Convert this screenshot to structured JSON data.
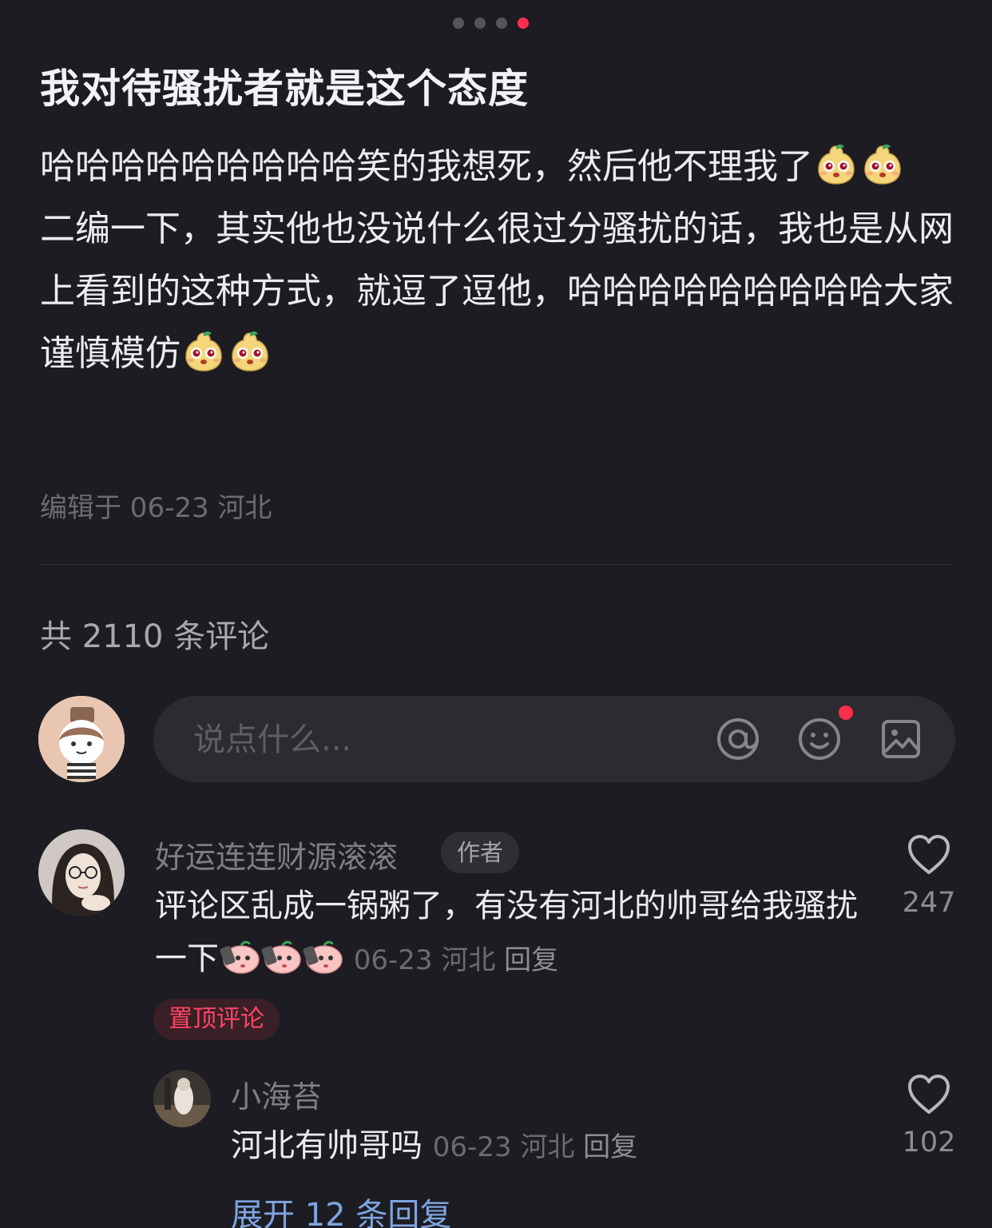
{
  "carousel": {
    "total": 4,
    "active_index": 3
  },
  "post": {
    "title": "我对待骚扰者就是这个态度",
    "body_line1": "哈哈哈哈哈哈哈哈哈笑的我想死，然后他不理我了",
    "body_line2": "二编一下，其实他也没说什么很过分骚扰的话，我也是从网上看到的这种方式，就逗了逗他，哈哈哈哈哈哈哈哈哈大家谨慎模仿",
    "meta": "编辑于 06-23 河北"
  },
  "comments_header": {
    "count_label": "共 2110 条评论"
  },
  "composer": {
    "placeholder": "说点什么...",
    "icons": [
      "at-icon",
      "emoji-icon",
      "image-icon"
    ]
  },
  "comments": [
    {
      "username": "好运连连财源滚滚",
      "author_tag": "作者",
      "text": "评论区乱成一锅粥了，有没有河北的帅哥给我骚扰一下",
      "date": "06-23",
      "location": "河北",
      "reply_label": "回复",
      "pinned_label": "置顶评论",
      "likes": "247"
    }
  ],
  "replies": [
    {
      "username": "小海苔",
      "text": "河北有帅哥吗",
      "date": "06-23",
      "location": "河北",
      "reply_label": "回复",
      "likes": "102"
    }
  ],
  "expand_label": "展开 12 条回复",
  "colors": {
    "background": "#1d1c22",
    "accent_red": "#ff2e4d",
    "link_blue": "#7fa4e0"
  }
}
